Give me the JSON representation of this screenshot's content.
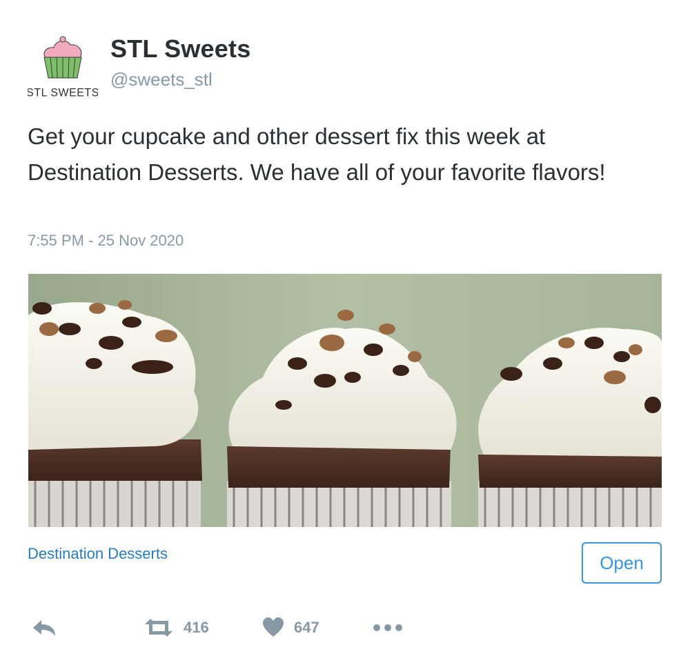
{
  "tweet": {
    "author": {
      "display_name": "STL Sweets",
      "handle": "@sweets_stl",
      "avatar_caption": "STL SWEETS"
    },
    "text": "Get your cupcake and other dessert fix this week at Destination Desserts. We have all of your favorite flavors!",
    "timestamp": "7:55 PM - 25 Nov 2020",
    "link_card": {
      "title": "Destination Desserts",
      "open_label": "Open"
    },
    "actions": {
      "retweet_count": "416",
      "like_count": "647"
    }
  },
  "colors": {
    "text": "#292f33",
    "muted": "#8899a6",
    "link": "#2b7bb9",
    "button_border": "#3b94d9"
  },
  "icons": [
    "reply-icon",
    "retweet-icon",
    "heart-icon",
    "more-icon"
  ]
}
